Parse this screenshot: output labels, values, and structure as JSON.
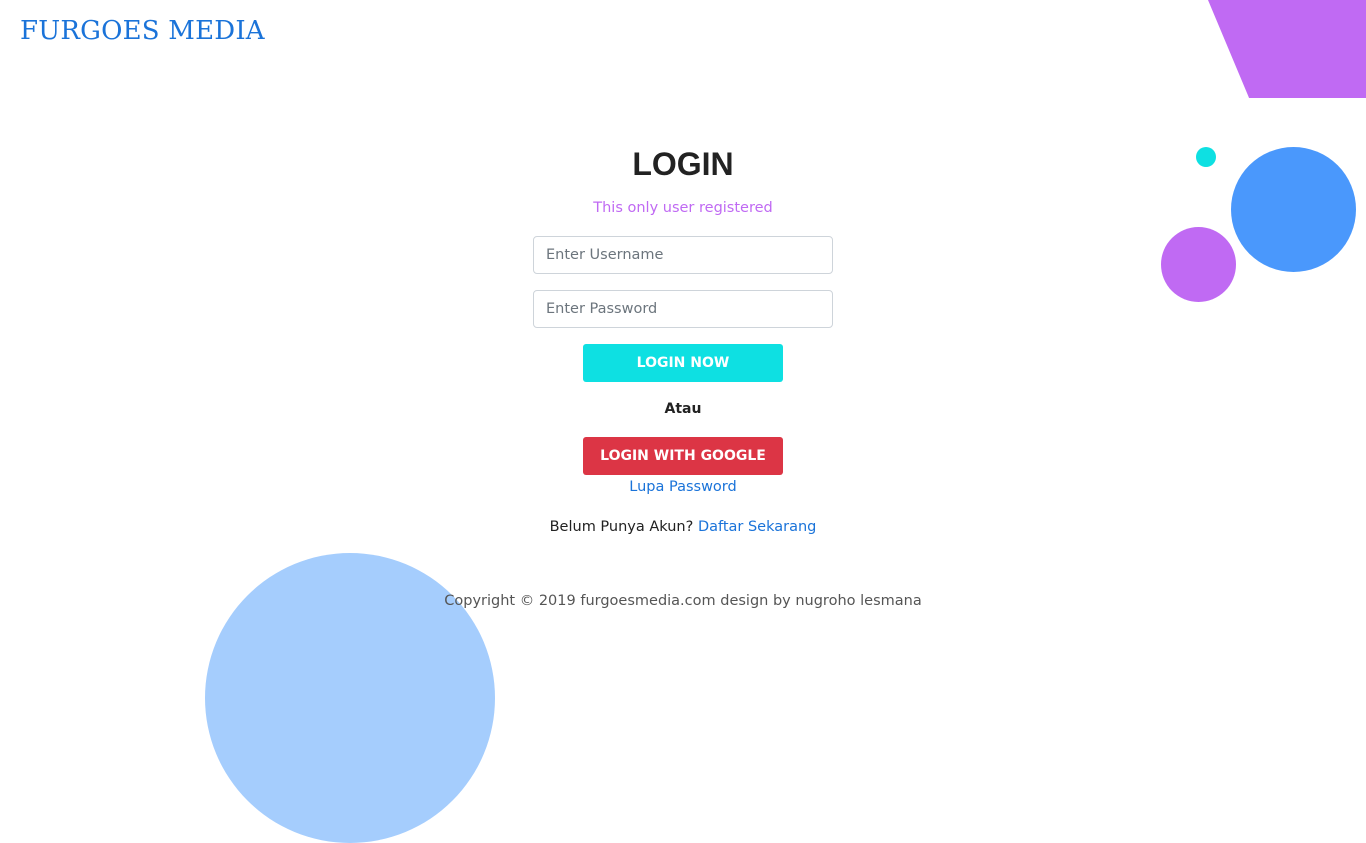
{
  "brand": {
    "name": "FURGOES MEDIA"
  },
  "login": {
    "title": "LOGIN",
    "subtitle": "This only user registered",
    "username_placeholder": "Enter Username",
    "password_placeholder": "Enter Password",
    "login_button": "LOGIN NOW",
    "separator": "Atau",
    "google_button": "LOGIN WITH GOOGLE",
    "forgot_link": "Lupa Password",
    "register_prompt": "Belum Punya Akun?",
    "register_link": "Daftar Sekarang"
  },
  "footer": {
    "copyright": "Copyright © 2019 furgoesmedia.com design by nugroho lesmana"
  },
  "colors": {
    "brand": "#1a73d9",
    "accent_purple": "#c06af3",
    "accent_teal": "#0ee0e2",
    "accent_blue": "#4a98fc",
    "accent_light_blue": "#a5cdfd",
    "danger_red": "#dc3545"
  }
}
